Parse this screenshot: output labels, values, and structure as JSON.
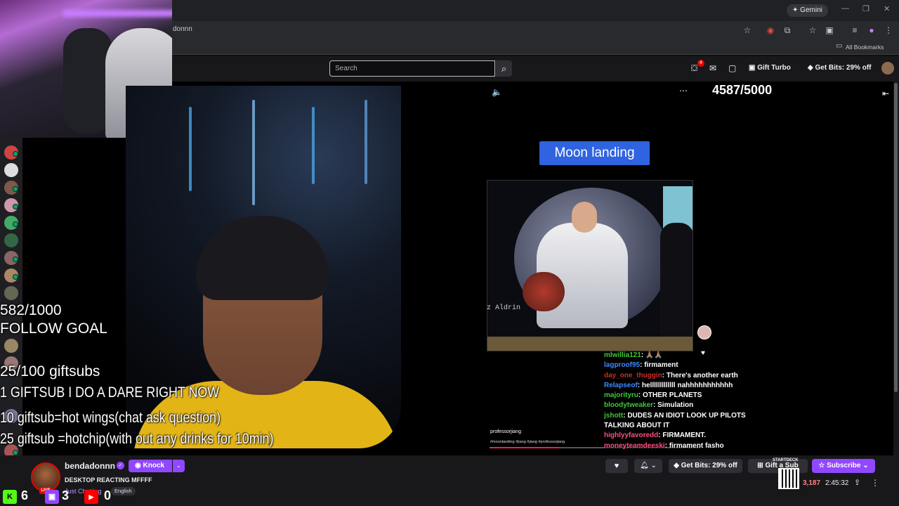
{
  "browser": {
    "gemini_label": "Gemini",
    "url": "donnn",
    "all_bookmarks": "All Bookmarks"
  },
  "nav": {
    "search_placeholder": "Search",
    "notification_count": "4",
    "gift_turbo": "Gift Turbo",
    "get_bits": "Get Bits: 29% off"
  },
  "overlay": {
    "follow_count": "582/1000",
    "follow_goal": "FOLLOW GOAL",
    "giftsubs_count": "25/100 giftsubs",
    "dare": "1 GIFTSUB I DO A DARE RIGHT NOW",
    "ten_gift": "10 giftsub=hot wings(chat ask question)",
    "twentyfive_gift": "25 giftsub =hotchip(with out any drinks for 10min)"
  },
  "clip": {
    "counter": "4587/5000",
    "title": "Moon landing",
    "photo_caption": "z Aldrin",
    "author": "professorjiang",
    "tags": "#moonlanding #jiang #jiang #professorjiang",
    "progress": 0.33
  },
  "chat": [
    {
      "user": "mlwillia121",
      "message": "🙏🏽🙏🏽",
      "color": "#41c73a"
    },
    {
      "user": "lagproof95",
      "message": "firmament",
      "color": "#3d8bff"
    },
    {
      "user": "day_one_thuggin",
      "message": "There's another earth",
      "color": "#c4302b"
    },
    {
      "user": "Relapseof",
      "message": "helllllllllllll nahhhhhhhhhhh",
      "color": "#3d8bff"
    },
    {
      "user": "majorityru",
      "message": "OTHER PLANETS",
      "color": "#41c73a"
    },
    {
      "user": "bloodytweaker",
      "message": "Simulation",
      "color": "#41c73a"
    },
    {
      "user": "jshott",
      "message": "DUDES AN IDIOT LOOK UP PILOTS TALKING ABOUT IT",
      "color": "#41c73a"
    },
    {
      "user": "highlyyfavoredd",
      "message": "FIRMAMENT.",
      "color": "#ff4f7f"
    },
    {
      "user": "moneyteamdeeski",
      "message": "firmament fasho",
      "color": "#ff4f7f"
    }
  ],
  "channel": {
    "name": "bendadonnn",
    "knock": "Knock",
    "live": "LIVE",
    "title": "DESKTOP REACTING MFFFF",
    "category": "Just Chatting",
    "language": "English"
  },
  "sub_counts": {
    "kick": "6",
    "twitch": "3",
    "youtube": "0"
  },
  "actions": {
    "get_bits": "Get Bits: 29% off",
    "gift_a_sub": "Gift a Sub",
    "subscribe": "Subscribe",
    "qr_label": "STARTDECK"
  },
  "stats": {
    "viewers": "3,187",
    "uptime": "2:45:32"
  },
  "colors": {
    "twitch_purple": "#9147ff",
    "live_red": "#eb0400",
    "moon_title_bg": "#2f63e0"
  }
}
